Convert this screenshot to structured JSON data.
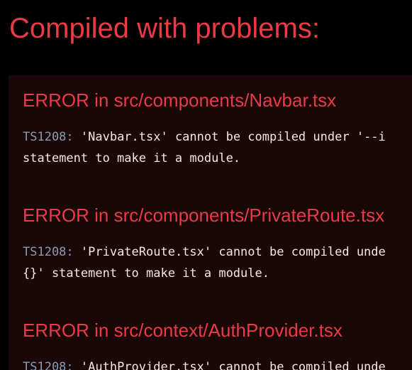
{
  "overlay": {
    "title": "Compiled with problems:"
  },
  "errors": [
    {
      "header": "ERROR in src/components/Navbar.tsx",
      "code": "TS1208:",
      "line1": " 'Navbar.tsx' cannot be compiled under '--i",
      "line2": "statement to make it a module."
    },
    {
      "header": "ERROR in src/components/PrivateRoute.tsx",
      "code": "TS1208:",
      "line1": " 'PrivateRoute.tsx' cannot be compiled unde",
      "line2": "{}' statement to make it a module."
    },
    {
      "header": "ERROR in src/context/AuthProvider.tsx",
      "code": "TS1208:",
      "line1": " 'AuthProvider.tsx' cannot be compiled unde"
    }
  ],
  "colors": {
    "background": "#000000",
    "panel": "#1a0708",
    "error_red": "#e83b46",
    "message_text": "#fbe4e4",
    "code_text": "#8a9bb3"
  }
}
